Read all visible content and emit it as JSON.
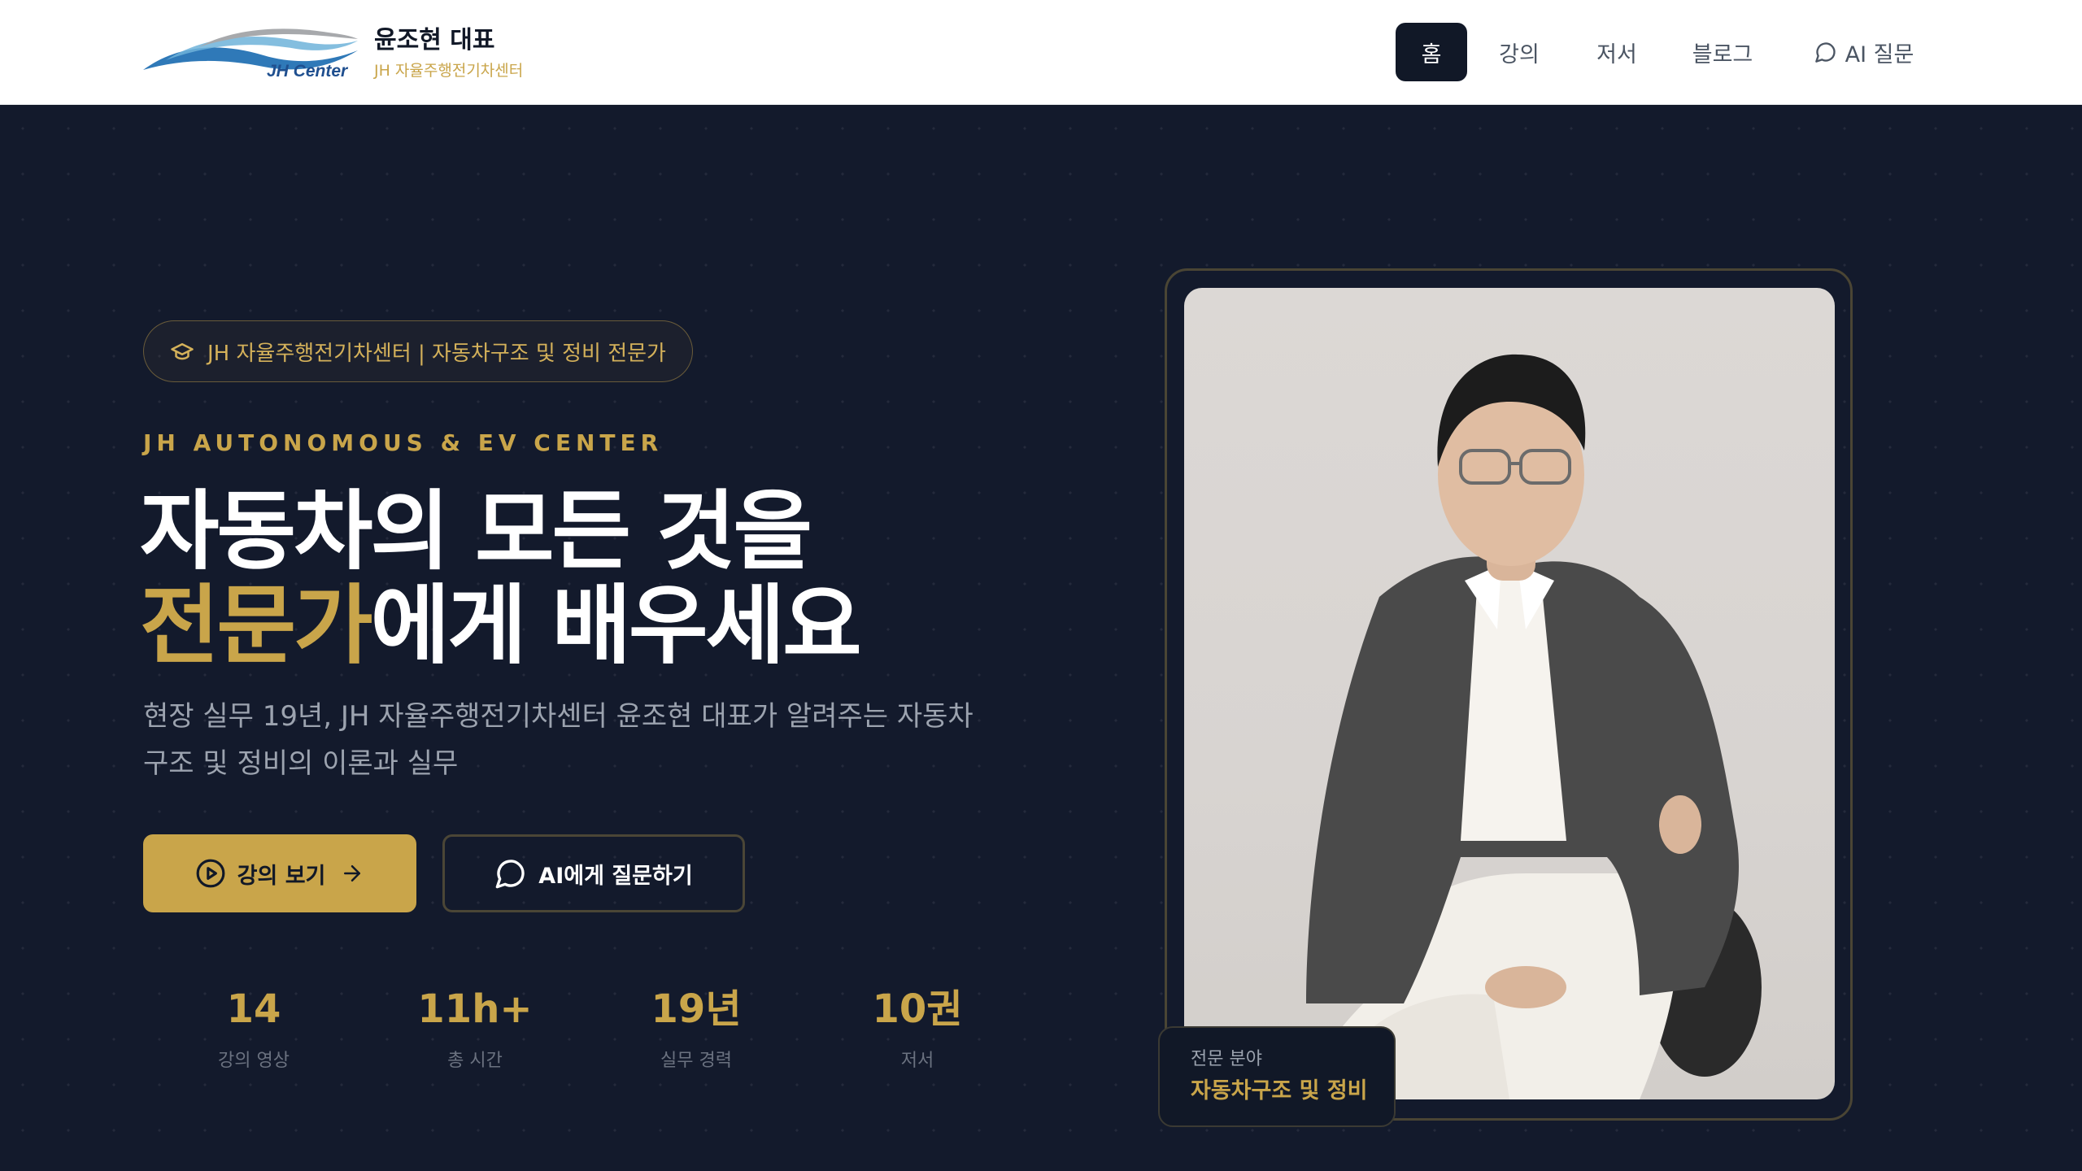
{
  "header": {
    "logo_text": "JH Center",
    "brand_name": "윤조현 대표",
    "brand_sub": "JH 자율주행전기차센터",
    "nav": [
      {
        "label": "홈",
        "active": true
      },
      {
        "label": "강의",
        "active": false
      },
      {
        "label": "저서",
        "active": false
      },
      {
        "label": "블로그",
        "active": false
      },
      {
        "label": "AI 질문",
        "active": false,
        "icon": "chat-bubble-icon"
      }
    ]
  },
  "hero": {
    "pill": "JH 자율주행전기차센터 | 자동차구조 및 정비 전문가",
    "eyebrow": "JH AUTONOMOUS & EV CENTER",
    "headline_line1": "자동차의 모든 것을",
    "headline_highlight": "전문가",
    "headline_rest": "에게 배우세요",
    "description": "현장 실무 19년, JH 자율주행전기차센터 윤조현 대표가 알려주는 자동차 구조 및 정비의 이론과 실무",
    "primary_button": "강의 보기",
    "secondary_button": "AI에게 질문하기",
    "stats": [
      {
        "value": "14",
        "label": "강의 영상"
      },
      {
        "value": "11h+",
        "label": "총 시간"
      },
      {
        "value": "19년",
        "label": "실무 경력"
      },
      {
        "value": "10권",
        "label": "저서"
      }
    ]
  },
  "profile_card": {
    "badge_label": "전문 분야",
    "badge_value": "자동차구조 및 정비"
  },
  "colors": {
    "accent": "#c9a54a",
    "background": "#131a2c",
    "header_bg": "#ffffff",
    "nav_active": "#111827"
  }
}
